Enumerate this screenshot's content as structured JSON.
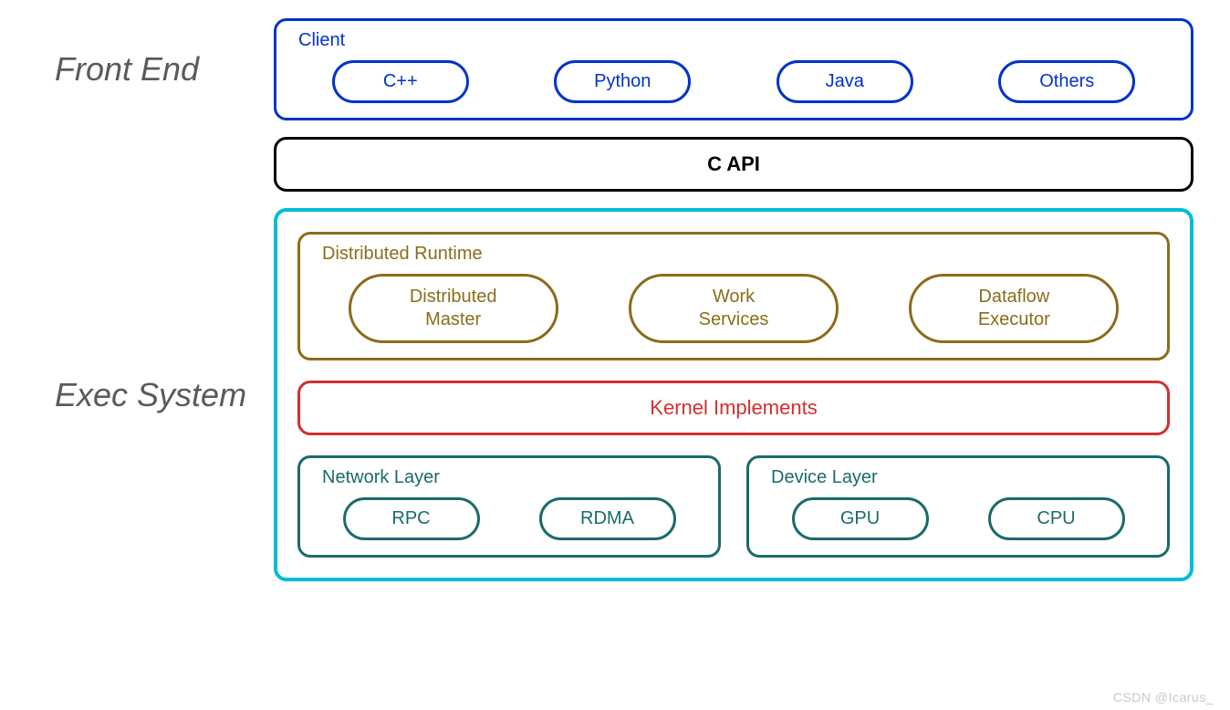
{
  "frontEnd": {
    "label": "Front End",
    "client": {
      "title": "Client",
      "items": [
        "C++",
        "Python",
        "Java",
        "Others"
      ]
    }
  },
  "capi": {
    "title": "C API"
  },
  "execSystem": {
    "label": "Exec System",
    "runtime": {
      "title": "Distributed Runtime",
      "items": [
        "Distributed Master",
        "Work Services",
        "Dataflow Executor"
      ]
    },
    "kernel": {
      "title": "Kernel Implements"
    },
    "network": {
      "title": "Network Layer",
      "items": [
        "RPC",
        "RDMA"
      ]
    },
    "device": {
      "title": "Device Layer",
      "items": [
        "GPU",
        "CPU"
      ]
    }
  },
  "watermark": "CSDN @Icarus_"
}
